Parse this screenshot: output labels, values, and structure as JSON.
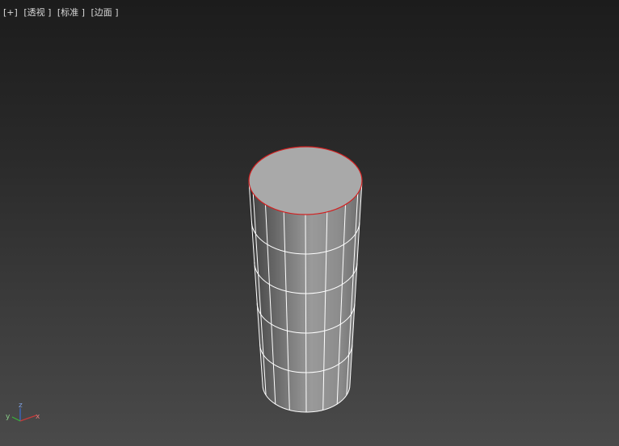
{
  "viewport": {
    "menu_plus": "[+]",
    "menu_view": "[透视 ]",
    "menu_shading": "[标准 ]",
    "menu_edges": "[边面 ]"
  },
  "object": {
    "type": "cylinder",
    "height_segments": 5,
    "sides": 16,
    "top_cap_outline_color": "#d22020",
    "wire_color": "#ffffff",
    "body_color": "#8a8a8a"
  },
  "axis_gizmo": {
    "x_label": "x",
    "y_label": "y",
    "z_label": "z",
    "x_color": "#c83a3a",
    "y_color": "#3ab43a",
    "z_color": "#3a6ad2"
  }
}
